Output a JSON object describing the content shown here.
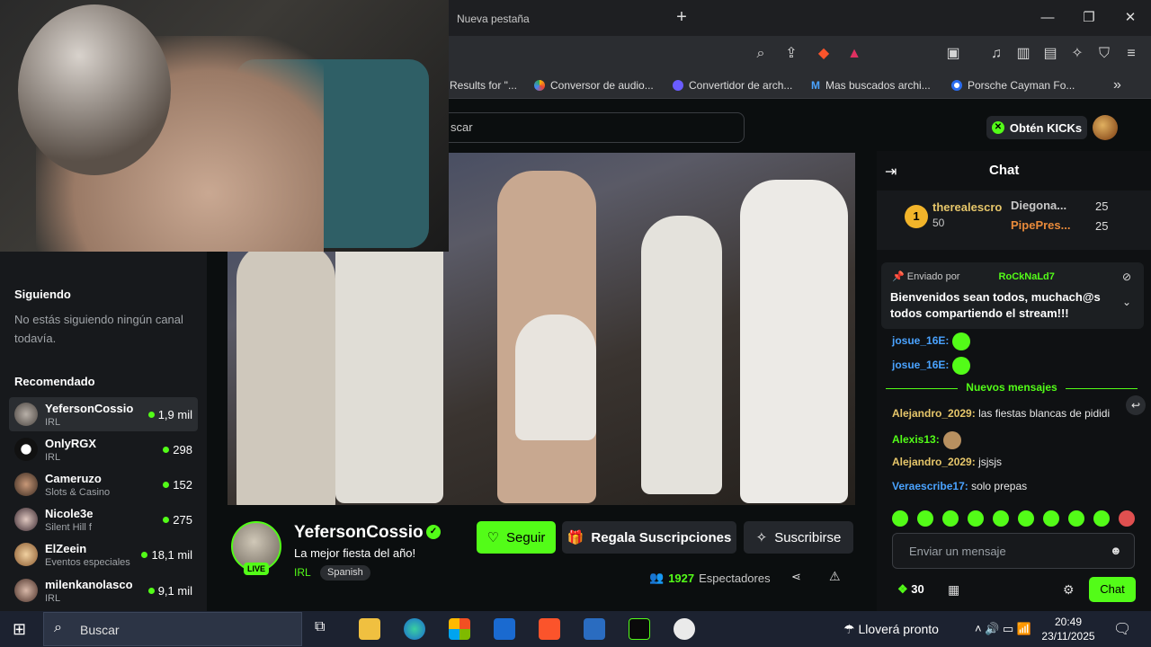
{
  "browser": {
    "tab_title": "Nueva pestaña",
    "bookmarks": [
      {
        "label": "Results for \"..."
      },
      {
        "label": "Conversor de audio..."
      },
      {
        "label": "Convertidor de arch..."
      },
      {
        "label": "Mas buscados archi..."
      },
      {
        "label": "Porsche Cayman Fo..."
      }
    ]
  },
  "header": {
    "search_placeholder": "scar",
    "kicks_button": "Obtén KICKs"
  },
  "sidebar": {
    "following_title": "Siguiendo",
    "following_empty": "No estás siguiendo ningún canal todavía.",
    "recommended_title": "Recomendado",
    "channels": [
      {
        "name": "YefersonCossio",
        "category": "IRL",
        "viewers": "1,9 mil"
      },
      {
        "name": "OnlyRGX",
        "category": "IRL",
        "viewers": "298"
      },
      {
        "name": "Cameruzo",
        "category": "Slots & Casino",
        "viewers": "152"
      },
      {
        "name": "Nicole3e",
        "category": "Silent Hill f",
        "viewers": "275"
      },
      {
        "name": "ElZeein",
        "category": "Eventos especiales",
        "viewers": "18,1 mil"
      },
      {
        "name": "milenkanolasco",
        "category": "IRL",
        "viewers": "9,1 mil"
      }
    ]
  },
  "stream": {
    "live_badge": "LIVE",
    "streamer": "YefersonCossio",
    "title": "La mejor fiesta del año!",
    "category": "IRL",
    "language": "Spanish",
    "follow_label": "Seguir",
    "gift_label": "Regala Suscripciones",
    "subscribe_label": "Suscribirse",
    "viewers_count": "1927",
    "viewers_label": "Espectadores"
  },
  "chat": {
    "title": "Chat",
    "leaderboard": {
      "top": {
        "rank": "1",
        "name": "therealescro",
        "amount": "50"
      },
      "others": [
        {
          "name": "Diegona...",
          "amount": "25"
        },
        {
          "name": "PipePres...",
          "amount": "25"
        }
      ]
    },
    "pinned": {
      "sent_by_label": "Enviado por",
      "sender": "RoCkNaLd7",
      "text": "Bienvenidos sean todos, muchach@s todos compartiendo el stream!!!"
    },
    "messages_before": [
      {
        "user": "josue_16E:",
        "text": ""
      },
      {
        "user": "josue_16E:",
        "text": ""
      }
    ],
    "new_messages_label": "Nuevos mensajes",
    "messages_after": [
      {
        "user": "Alejandro_2029:",
        "text": "las fiestas blancas de pididi"
      },
      {
        "user": "Alexis13:",
        "text": ""
      },
      {
        "user": "Alejandro_2029:",
        "text": "jsjsjs"
      },
      {
        "user": "Veraescribe17:",
        "text": "solo prepas"
      }
    ],
    "input_placeholder": "Enviar un mensaje",
    "kicks_count": "30",
    "send_label": "Chat"
  },
  "taskbar": {
    "search_label": "Buscar",
    "weather": "Lloverá pronto",
    "time": "20:49",
    "date": "23/11/2025"
  },
  "colors": {
    "kick_green": "#53fc18",
    "background": "#0b0e0f"
  }
}
